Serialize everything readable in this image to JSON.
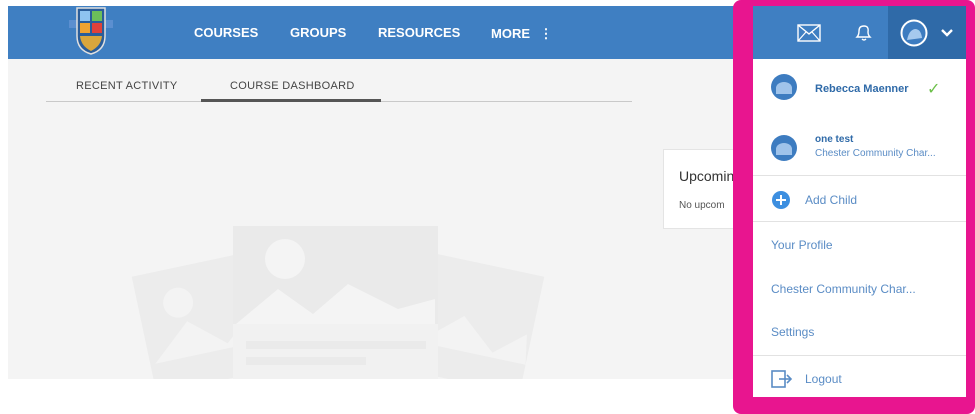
{
  "nav": {
    "courses": "COURSES",
    "groups": "GROUPS",
    "resources": "RESOURCES",
    "more": "MORE",
    "more_icon": "⋮"
  },
  "tabs": {
    "recent_activity": "RECENT ACTIVITY",
    "course_dashboard": "COURSE DASHBOARD"
  },
  "upcoming": {
    "title": "Upcomin",
    "text": "No upcom"
  },
  "user_menu": {
    "accounts": [
      {
        "name": "Rebecca Maenner",
        "check": "✓"
      },
      {
        "name": "one test",
        "school": "Chester Community Char..."
      }
    ],
    "add_child": "Add Child",
    "your_profile": "Your Profile",
    "school": "Chester Community Char...",
    "settings": "Settings",
    "logout": "Logout"
  },
  "colors": {
    "topbar": "#3f7fc2",
    "highlight_frame": "#e8158f",
    "link": "#5a8cc5"
  }
}
